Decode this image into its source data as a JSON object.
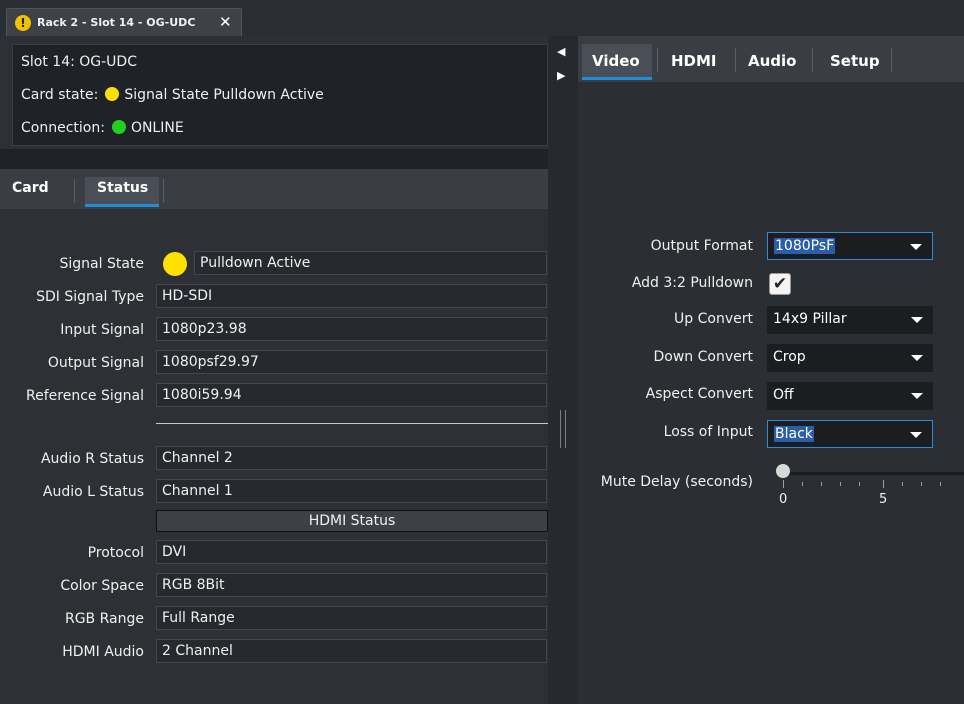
{
  "doc_tab": {
    "title": "Rack 2 - Slot 14 - OG-UDC",
    "warn_glyph": "!",
    "close_glyph": "✕"
  },
  "info": {
    "slot": "Slot 14: OG-UDC",
    "card_state_label": "Card state:",
    "card_state_value": "Signal State Pulldown Active",
    "card_state_color": "#ffe100",
    "connection_label": "Connection:",
    "connection_value": "ONLINE",
    "connection_color": "#20d020"
  },
  "left_tabs": [
    {
      "label": "Card",
      "active": false
    },
    {
      "label": "Status",
      "active": true
    }
  ],
  "status": {
    "signal_state": {
      "label": "Signal State",
      "value": "Pulldown Active",
      "indicator_color": "#ffe100"
    },
    "rows_video": [
      {
        "label": "SDI Signal Type",
        "value": "HD-SDI"
      },
      {
        "label": "Input Signal",
        "value": "1080p23.98"
      },
      {
        "label": "Output Signal",
        "value": "1080psf29.97"
      },
      {
        "label": "Reference Signal",
        "value": "1080i59.94"
      }
    ],
    "rows_audio": [
      {
        "label": "Audio R Status",
        "value": "Channel 2"
      },
      {
        "label": "Audio L Status",
        "value": "Channel 1"
      }
    ],
    "hdmi_header": "HDMI Status",
    "rows_hdmi": [
      {
        "label": "Protocol",
        "value": "DVI"
      },
      {
        "label": "Color Space",
        "value": "RGB 8Bit"
      },
      {
        "label": "RGB Range",
        "value": "Full Range"
      },
      {
        "label": "HDMI Audio",
        "value": "2 Channel"
      }
    ]
  },
  "splitter": {
    "collapse_glyph": "◀",
    "expand_glyph": "▶"
  },
  "right_tabs": [
    {
      "label": "Video",
      "active": true
    },
    {
      "label": "HDMI",
      "active": false
    },
    {
      "label": "Audio",
      "active": false
    },
    {
      "label": "Setup",
      "active": false
    }
  ],
  "video": {
    "output_format": {
      "label": "Output Format",
      "value": "1080PsF"
    },
    "pulldown": {
      "label": "Add 3:2 Pulldown",
      "checked": true,
      "check_glyph": "✔"
    },
    "up_convert": {
      "label": "Up Convert",
      "value": "14x9 Pillar"
    },
    "down_convert": {
      "label": "Down Convert",
      "value": "Crop"
    },
    "aspect_convert": {
      "label": "Aspect Convert",
      "value": "Off"
    },
    "loss_of_input": {
      "label": "Loss of Input",
      "value": "Black"
    },
    "mute_delay": {
      "label": "Mute Delay (seconds)",
      "value": 0,
      "tick_labels": [
        "0",
        "5"
      ]
    }
  },
  "colors": {
    "accent": "#1e8ed6",
    "panel_bg": "#2d3035",
    "field_bg": "#26292d"
  }
}
